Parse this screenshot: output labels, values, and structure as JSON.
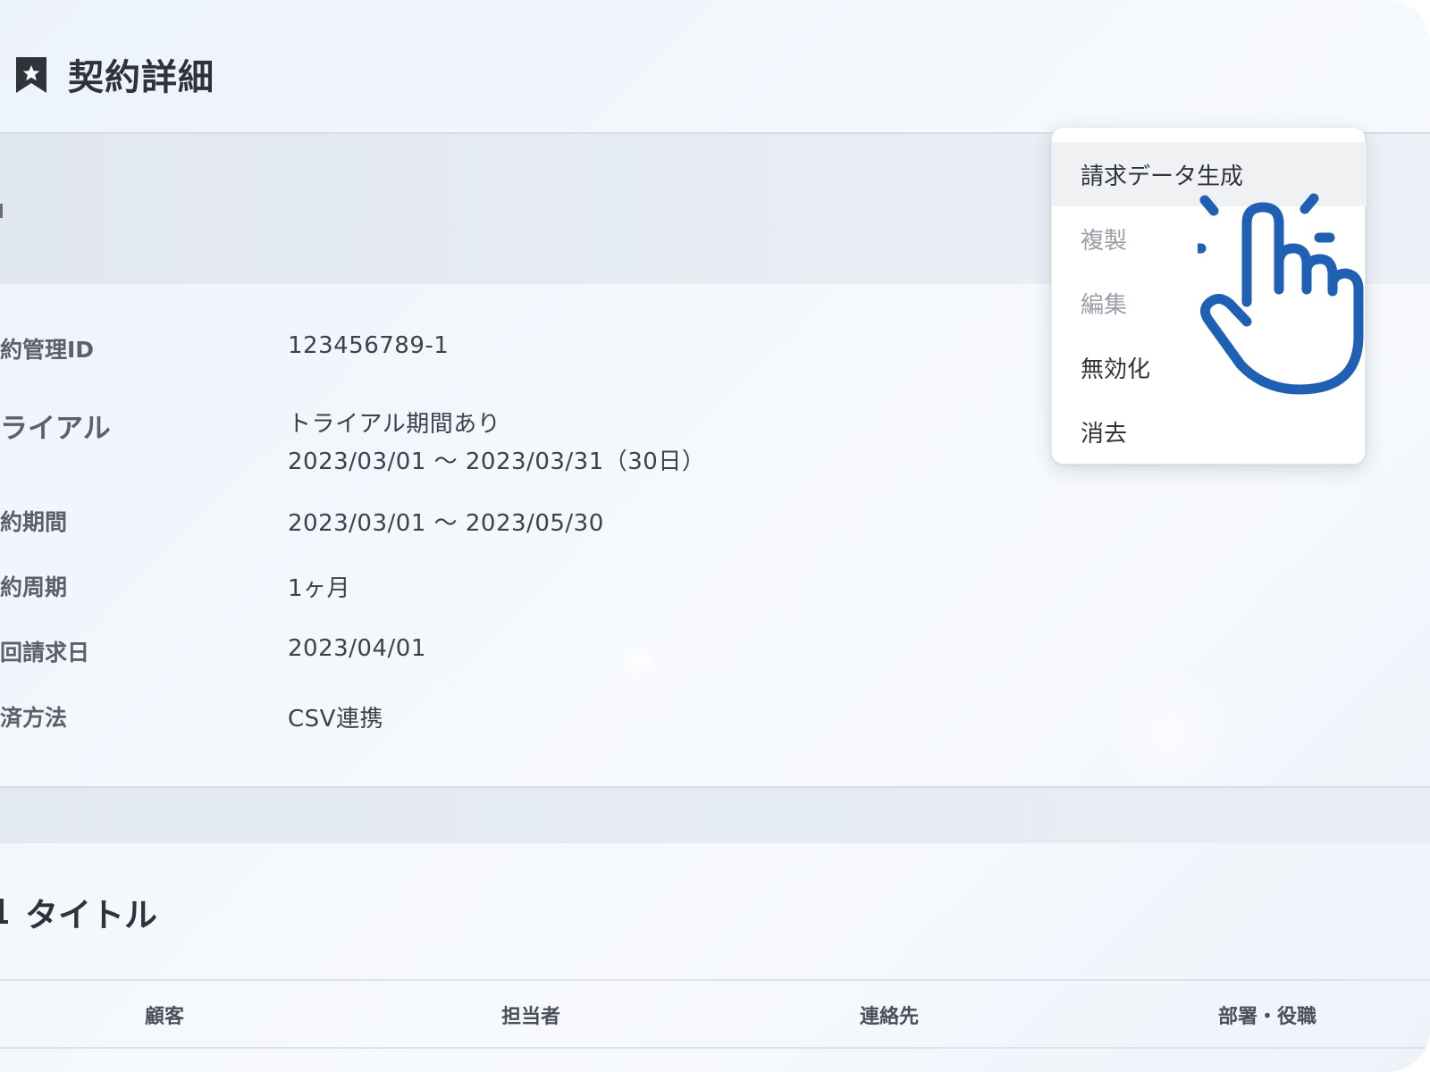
{
  "header": {
    "title": "契約詳細",
    "icon": "bookmark-star-icon"
  },
  "details": [
    {
      "label": "約管理ID",
      "value": "123456789-1"
    },
    {
      "label": "ライアル",
      "value_lines": [
        "トライアル期間あり",
        "2023/03/01 〜 2023/03/31（30日）"
      ]
    },
    {
      "label": "約期間",
      "value": "2023/03/01 〜 2023/05/30"
    },
    {
      "label": "約周期",
      "value": "1ヶ月"
    },
    {
      "label": "回請求日",
      "value": "2023/04/01"
    },
    {
      "label": "済方法",
      "value": "CSV連携"
    }
  ],
  "section2": {
    "title": "タイトル"
  },
  "table": {
    "columns": [
      "顧客",
      "担当者",
      "連絡先",
      "部署・役職"
    ]
  },
  "menu": {
    "items": [
      {
        "label": "請求データ生成",
        "state": "hover"
      },
      {
        "label": "複製",
        "state": "disabled"
      },
      {
        "label": "編集",
        "state": "disabled"
      },
      {
        "label": "無効化",
        "state": "normal"
      },
      {
        "label": "消去",
        "state": "normal"
      }
    ]
  },
  "colors": {
    "accent": "#1f5fb4",
    "title_text": "#2e333b",
    "disabled_text": "#9aa0a8",
    "menu_hover": "#f0f1f3"
  },
  "cursor": {
    "icon": "pointing-hand-click-icon"
  }
}
